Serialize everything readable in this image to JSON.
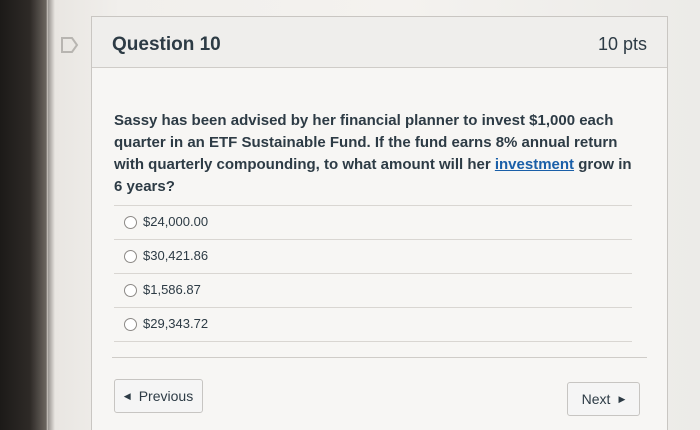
{
  "question": {
    "title": "Question 10",
    "points": "10 pts",
    "text_before_link": "Sassy has been advised by her financial planner to invest $1,000 each quarter in an ETF Sustainable Fund.  If the fund earns 8% annual return with quarterly compounding, to what amount will her ",
    "link_text": "investment",
    "text_after_link": " grow in 6 years?"
  },
  "answers": [
    {
      "label": "$24,000.00"
    },
    {
      "label": "$30,421.86"
    },
    {
      "label": "$1,586.87"
    },
    {
      "label": "$29,343.72"
    }
  ],
  "navigation": {
    "previous_label": "Previous",
    "next_label": "Next"
  },
  "icons": {
    "flag": "flag-icon",
    "previous_arrow": "triangle-left-icon",
    "next_arrow": "triangle-right-icon"
  },
  "colors": {
    "text": "#2d3b45",
    "link": "#1a5fa8"
  }
}
